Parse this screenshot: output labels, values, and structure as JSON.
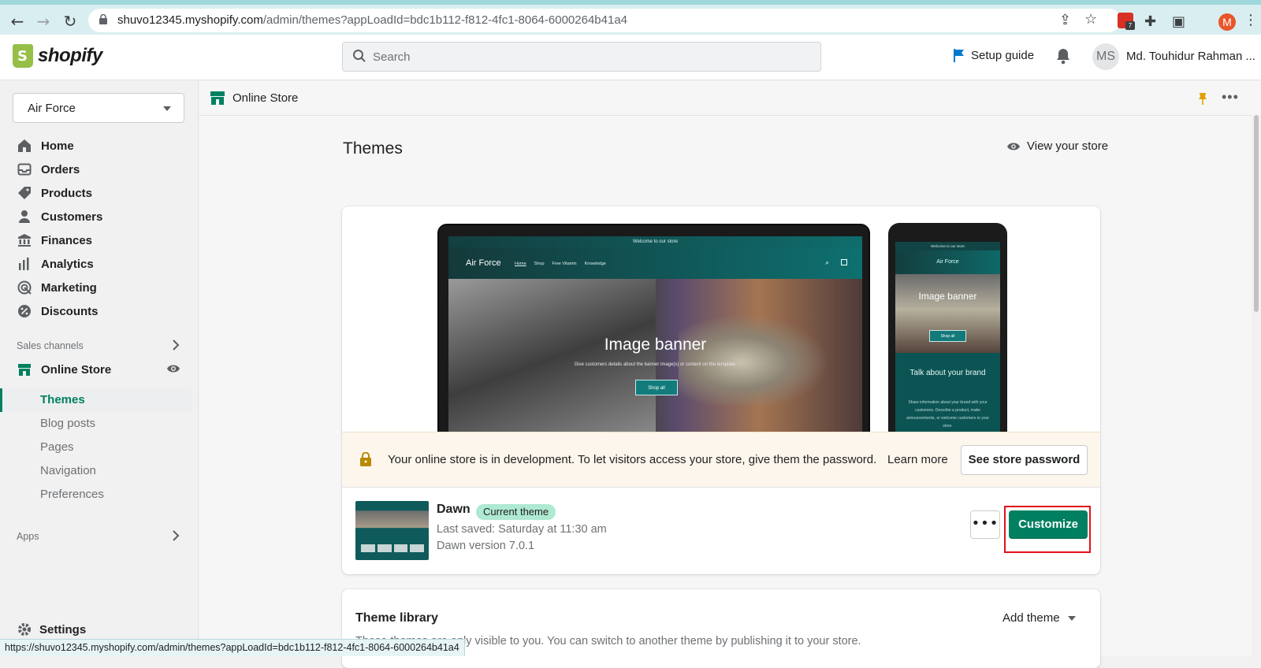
{
  "browser": {
    "url_host": "shuvo12345.myshopify.com",
    "url_path": "/admin/themes?appLoadId=bdc1b112-f812-4fc1-8064-6000264b41a4",
    "profile_initial": "M",
    "extension_badge": "7"
  },
  "topbar": {
    "brand": "shopify",
    "search_placeholder": "Search",
    "setup_guide": "Setup guide",
    "user_initials": "MS",
    "user_name": "Md. Touhidur Rahman ..."
  },
  "sidebar": {
    "store_name": "Air Force",
    "items": [
      {
        "label": "Home",
        "icon": "home-icon"
      },
      {
        "label": "Orders",
        "icon": "orders-icon"
      },
      {
        "label": "Products",
        "icon": "tag-icon"
      },
      {
        "label": "Customers",
        "icon": "person-icon"
      },
      {
        "label": "Finances",
        "icon": "bank-icon"
      },
      {
        "label": "Analytics",
        "icon": "bar-chart-icon"
      },
      {
        "label": "Marketing",
        "icon": "target-icon"
      },
      {
        "label": "Discounts",
        "icon": "discount-icon"
      }
    ],
    "sales_channels_label": "Sales channels",
    "online_store": "Online Store",
    "sub_items": [
      "Themes",
      "Blog posts",
      "Pages",
      "Navigation",
      "Preferences"
    ],
    "apps_label": "Apps",
    "settings": "Settings"
  },
  "subheader": {
    "title": "Online Store"
  },
  "page": {
    "title": "Themes",
    "view_store": "View your store"
  },
  "preview": {
    "announcement": "Welcome to our store",
    "brand": "Air Force",
    "menu": [
      "Home",
      "Shop",
      "Free Vitamin",
      "Knowledge"
    ],
    "banner_title": "Image banner",
    "banner_subtitle": "Give customers details about the banner image(s) or content on the template.",
    "shop_all": "Shop all",
    "talk_title": "Talk about your brand",
    "talk_text": "Share information about your brand with your customers. Describe a product, make announcements, or welcome customers to your store."
  },
  "notice": {
    "text": "Your online store is in development. To let visitors access your store, give them the password.",
    "learn_more": "Learn more",
    "button": "See store password"
  },
  "theme": {
    "name": "Dawn",
    "badge": "Current theme",
    "last_saved": "Last saved: Saturday at 11:30 am",
    "version": "Dawn version 7.0.1",
    "more": "•••",
    "customize": "Customize"
  },
  "library": {
    "title": "Theme library",
    "add_theme": "Add theme",
    "description": "These themes are only visible to you. You can switch to another theme by publishing it to your store."
  },
  "status_bar": {
    "url": "https://shuvo12345.myshopify.com/admin/themes?appLoadId=bdc1b112-f812-4fc1-8064-6000264b41a4"
  },
  "colors": {
    "primary": "#008060",
    "badge_bg": "#aee9d1",
    "highlight_outline": "#e0121a",
    "brand_green": "#95bf47"
  }
}
